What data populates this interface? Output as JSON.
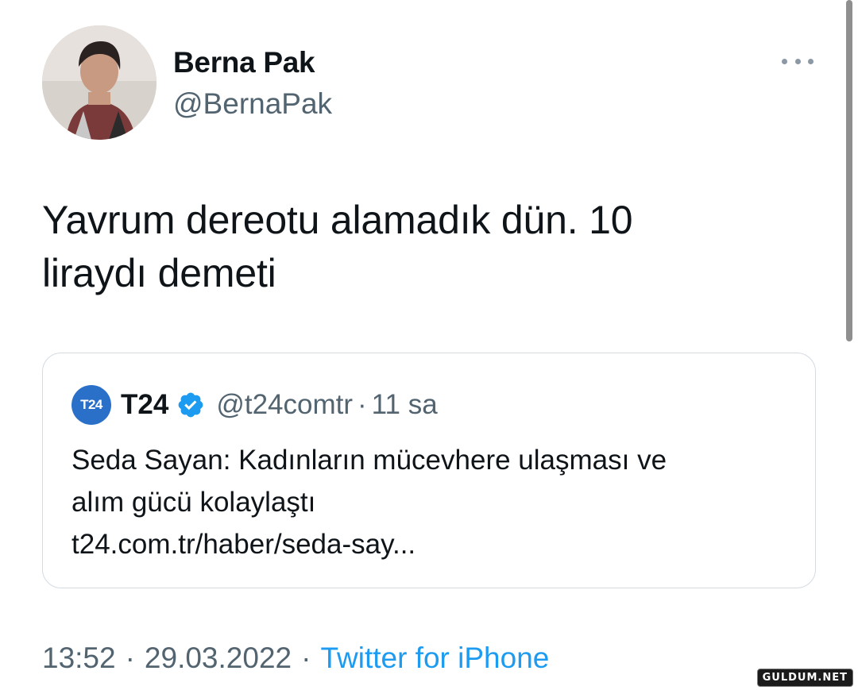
{
  "author": {
    "display_name": "Berna Pak",
    "handle": "@BernaPak",
    "avatar_icon": "user-avatar-photo"
  },
  "tweet": {
    "text_lines": [
      "Yavrum dereotu alamadık dün. 10",
      "liraydı demeti"
    ]
  },
  "quote": {
    "logo_text": "T24",
    "name": "T24",
    "verified_icon": "verified-badge-icon",
    "handle": "@t24comtr",
    "separator": "·",
    "time": "11 sa",
    "text_lines": [
      "Seda Sayan: Kadınların mücevhere ulaşması ve",
      "alım gücü kolaylaştı",
      "t24.com.tr/haber/seda-say..."
    ]
  },
  "footer": {
    "time": "13:52",
    "separator": "·",
    "date": "29.03.2022",
    "source": "Twitter for iPhone"
  },
  "watermark": "GULDUM.NET",
  "colors": {
    "text_primary": "#0f1419",
    "text_secondary": "#536471",
    "link_blue": "#1d9bf0",
    "t24_logo": "#2a6fc8",
    "border": "#d4dbe1"
  }
}
